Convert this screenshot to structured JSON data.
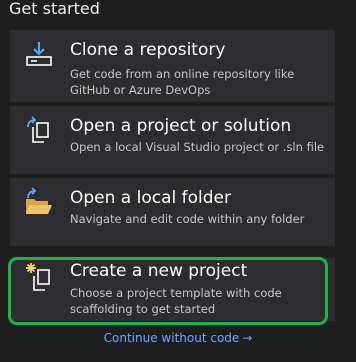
{
  "header": {
    "title": "Get started"
  },
  "cards": [
    {
      "title": "Clone a repository",
      "description": "Get code from an online repository like GitHub or Azure DevOps",
      "icon": "clone-download-icon"
    },
    {
      "title": "Open a project or solution",
      "description": "Open a local Visual Studio project or .sln file",
      "icon": "open-project-icon"
    },
    {
      "title": "Open a local folder",
      "description": "Navigate and edit code within any folder",
      "icon": "open-folder-icon"
    },
    {
      "title": "Create a new project",
      "description": "Choose a project template with code scaffolding to get started",
      "icon": "new-project-icon"
    }
  ],
  "footer": {
    "continue_label": "Continue without code",
    "arrow": "→"
  },
  "colors": {
    "background": "#1e1e1e",
    "card": "#2d2d30",
    "icon_blue": "#59a9ff",
    "folder_tan": "#d9a441",
    "highlight": "#21b24b",
    "link": "#6fa8ff"
  }
}
